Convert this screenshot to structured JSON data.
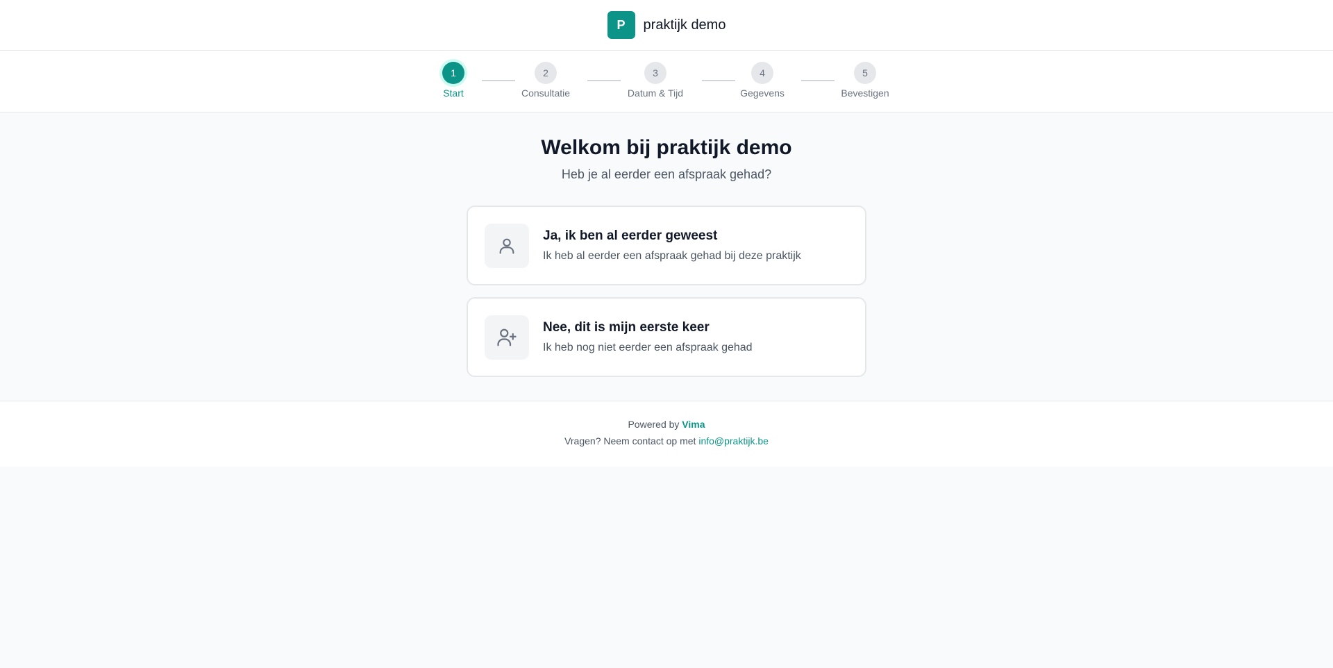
{
  "header": {
    "logo_letter": "P",
    "brand_name": "praktijk demo"
  },
  "stepper": {
    "steps": [
      {
        "number": "1",
        "label": "Start",
        "active": true
      },
      {
        "number": "2",
        "label": "Consultatie",
        "active": false
      },
      {
        "number": "3",
        "label": "Datum & Tijd",
        "active": false
      },
      {
        "number": "4",
        "label": "Gegevens",
        "active": false
      },
      {
        "number": "5",
        "label": "Bevestigen",
        "active": false
      }
    ]
  },
  "main": {
    "title": "Welkom bij praktijk demo",
    "subtitle": "Heb je al eerder een afspraak gehad?",
    "options": [
      {
        "icon": "user-icon",
        "title": "Ja, ik ben al eerder geweest",
        "description": "Ik heb al eerder een afspraak gehad bij deze praktijk"
      },
      {
        "icon": "user-plus-icon",
        "title": "Nee, dit is mijn eerste keer",
        "description": "Ik heb nog niet eerder een afspraak gehad"
      }
    ]
  },
  "footer": {
    "powered_prefix": "Powered by",
    "powered_brand": "Vima",
    "contact_prefix": "Vragen? Neem contact op met",
    "contact_email": "info@praktijk.be"
  },
  "colors": {
    "accent": "#0d9488",
    "accent_light": "#ccfbf1",
    "background": "#f9fafb"
  }
}
